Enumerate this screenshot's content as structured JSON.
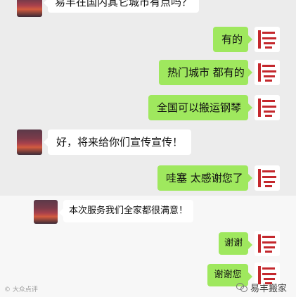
{
  "chat": {
    "messages": [
      {
        "side": "in",
        "text": "易丰在国内其它城市有点吗？"
      },
      {
        "side": "out",
        "text": "有的"
      },
      {
        "side": "out",
        "text": "热门城市 都有的"
      },
      {
        "side": "out",
        "text": "全国可以搬运钢琴"
      },
      {
        "side": "in",
        "text": "好，将来给你们宣传宣传！"
      },
      {
        "side": "out",
        "text": "哇塞  太感谢您了"
      },
      {
        "side": "in",
        "text": "本次服务我们全家都很满意！"
      },
      {
        "side": "out",
        "text": "谢谢"
      },
      {
        "side": "out",
        "text": "谢谢您"
      }
    ]
  },
  "footer": {
    "left_watermark": "© 大众点评",
    "right_label": "易丰搬家"
  },
  "colors": {
    "background": "#ececec",
    "panel": "#f7f7f7",
    "out_bubble": "#9fe85e",
    "in_bubble": "#ffffff",
    "logo_red": "#c4282d"
  },
  "icons": {
    "right_avatar": "yifeng-logo-icon",
    "left_avatar": "sunset-avatar-icon",
    "footer": "wechat-icon"
  }
}
